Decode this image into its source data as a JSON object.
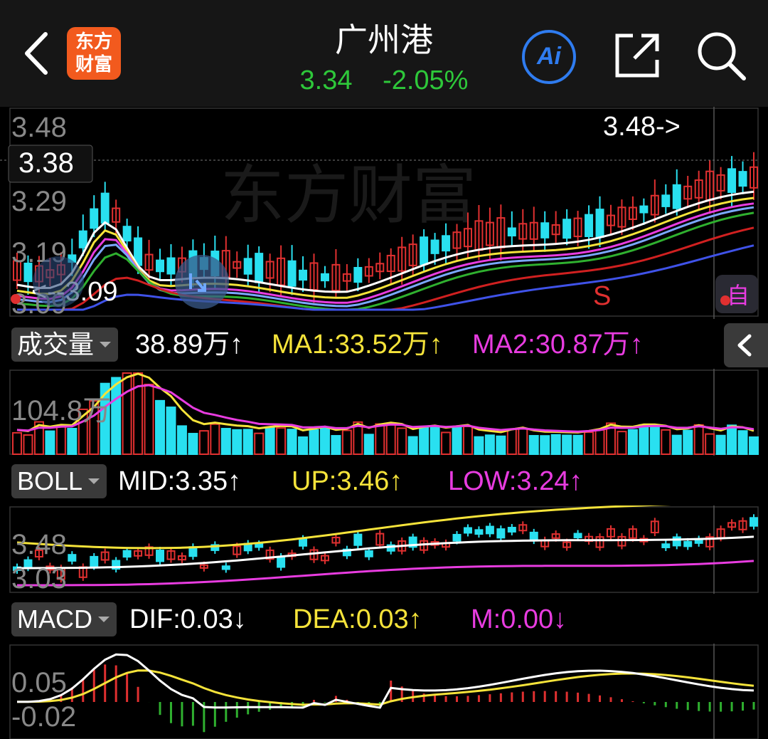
{
  "header": {
    "title": "广州港",
    "price": "3.34",
    "change_pct": "-2.05%",
    "logo_text_line1": "东方",
    "logo_text_line2": "财富",
    "ai_label": "Ai",
    "icons": [
      "back-arrow-icon",
      "ai-icon",
      "share-external-icon",
      "search-icon"
    ]
  },
  "main_chart": {
    "price_labels": [
      "3.48",
      "3.29",
      "3.19",
      "3.09"
    ],
    "crosshair_price": "3.38",
    "high_marker": "3.48->",
    "low_marker": "<--3.09",
    "sell_marker": "S",
    "self_button": "自",
    "watermark": "东方财富"
  },
  "volume": {
    "selector": "成交量",
    "value": "38.89万",
    "ma1": "MA1:33.52万",
    "ma2": "MA2:30.87万",
    "arrow_up": "↑",
    "axis_label": "104.8万"
  },
  "boll": {
    "selector": "BOLL",
    "mid": "MID:3.35",
    "up": "UP:3.46",
    "low": "LOW:3.24",
    "arrow_up": "↑",
    "axis_top": "3.48",
    "axis_bottom": "3.03"
  },
  "macd": {
    "selector": "MACD",
    "dif": "DIF:0.03",
    "dea": "DEA:0.03",
    "m": "M:0.00",
    "arrow_up": "↑",
    "arrow_down": "↓",
    "axis_top": "0.05",
    "axis_bottom": "-0.02"
  },
  "colors": {
    "up_red": "#e03030",
    "down_cyan": "#29e0f0",
    "ma_white": "#ffffff",
    "ma_yellow": "#f5e33a",
    "ma_magenta": "#e83ce0",
    "ma_green": "#2fb02f",
    "ma_blue": "#3f52e8",
    "ma_red": "#d02020",
    "ma_lightblue": "#7aa8ff",
    "price_green": "#2ec83a",
    "accent_orange": "#f25a1e"
  }
}
